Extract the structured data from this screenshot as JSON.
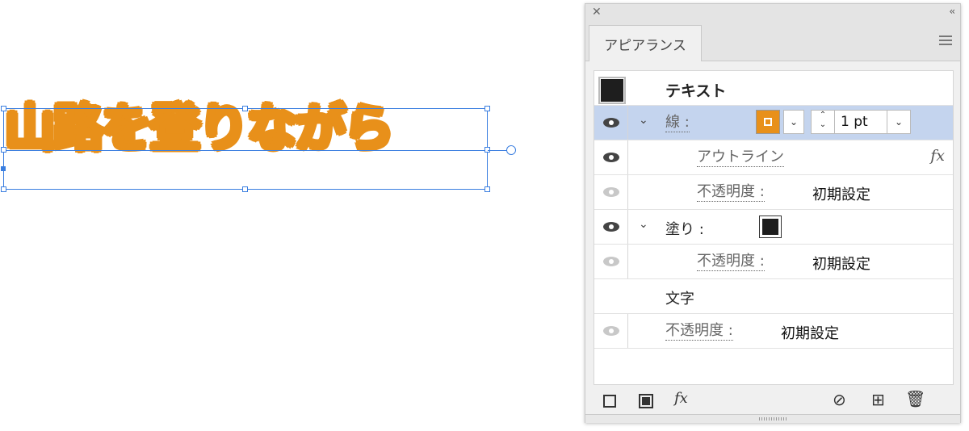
{
  "artwork": {
    "text": "山路を登りながら",
    "fill_color": "#e8901a",
    "stroke_color": "#222222",
    "selection_color": "#3a7ee0"
  },
  "panel": {
    "tab_label": "アピアランス",
    "close_icon": "close-icon",
    "collapse_icon": "double-chevron-left-icon",
    "menu_icon": "hamburger-menu-icon",
    "header": {
      "label": "テキスト"
    },
    "stroke_row": {
      "label": "線 :",
      "weight": "1 pt",
      "swatch_color": "#e8901a"
    },
    "outline_row": {
      "label": "アウトライン",
      "fx": "fx"
    },
    "stroke_opacity_row": {
      "label": "不透明度 :",
      "value": "初期設定"
    },
    "fill_row": {
      "label": "塗り :",
      "swatch_color": "#1e1e1e"
    },
    "fill_opacity_row": {
      "label": "不透明度 :",
      "value": "初期設定"
    },
    "characters_row": {
      "label": "文字"
    },
    "text_opacity_row": {
      "label": "不透明度 :",
      "value": "初期設定"
    },
    "bottom_toolbar": {
      "fx_label": "fx"
    }
  }
}
